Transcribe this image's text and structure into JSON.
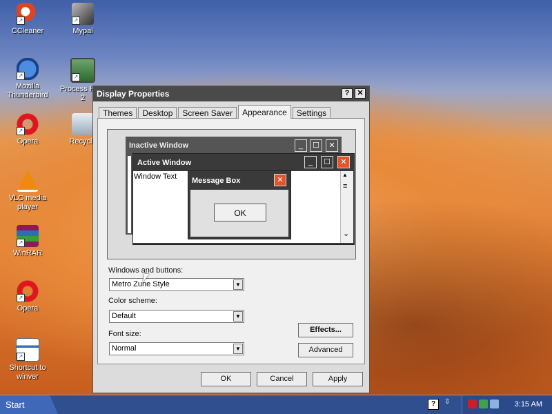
{
  "desktop": {
    "icons": [
      {
        "label": "CCleaner",
        "icon": "ccleaner-icon"
      },
      {
        "label": "Mypal",
        "icon": "mypal-icon"
      },
      {
        "label": "Mozilla Thunderbird",
        "icon": "thunderbird-icon"
      },
      {
        "label": "Process Ha... 2",
        "icon": "process-hacker-icon"
      },
      {
        "label": "Opera",
        "icon": "opera-icon"
      },
      {
        "label": "Recycle",
        "icon": "recycle-bin-icon"
      },
      {
        "label": "VLC media player",
        "icon": "vlc-icon"
      },
      {
        "label": "WinRAR",
        "icon": "winrar-icon"
      },
      {
        "label": "Opera",
        "icon": "opera-icon"
      },
      {
        "label": "Shortcut to winver",
        "icon": "shortcut-winver-icon"
      }
    ]
  },
  "window": {
    "title": "Display Properties",
    "help_glyph": "?",
    "close_glyph": "✕",
    "tabs": [
      {
        "label": "Themes"
      },
      {
        "label": "Desktop"
      },
      {
        "label": "Screen Saver"
      },
      {
        "label": "Appearance",
        "active": true
      },
      {
        "label": "Settings"
      }
    ],
    "preview": {
      "inactive_title": "Inactive Window",
      "active_title": "Active Window",
      "window_text": "Window Text",
      "message_box_title": "Message Box",
      "ok_label": "OK",
      "minimize_glyph": "_",
      "maximize_glyph": "☐",
      "close_glyph": "✕",
      "scroll_up_glyph": "▲",
      "scroll_down_glyph": "⌄",
      "scroll_thumb_glyph": "≡"
    },
    "windows_and_buttons": {
      "label": "Windows and buttons:",
      "value": "Metro Zune Style"
    },
    "color_scheme": {
      "label": "Color scheme:",
      "value": "Default"
    },
    "font_size": {
      "label": "Font size:",
      "value": "Normal"
    },
    "effects_label": "Effects...",
    "advanced_label": "Advanced",
    "ok_label": "OK",
    "cancel_label": "Cancel",
    "apply_label": "Apply",
    "dropdown_glyph": "▼"
  },
  "taskbar": {
    "start_label": "Start",
    "help_glyph": "?",
    "clock": "3:15 AM"
  },
  "colors": {
    "title_bar": "#4a4a4a",
    "close_red": "#e0552b",
    "taskbar": "#2f4f8f"
  }
}
